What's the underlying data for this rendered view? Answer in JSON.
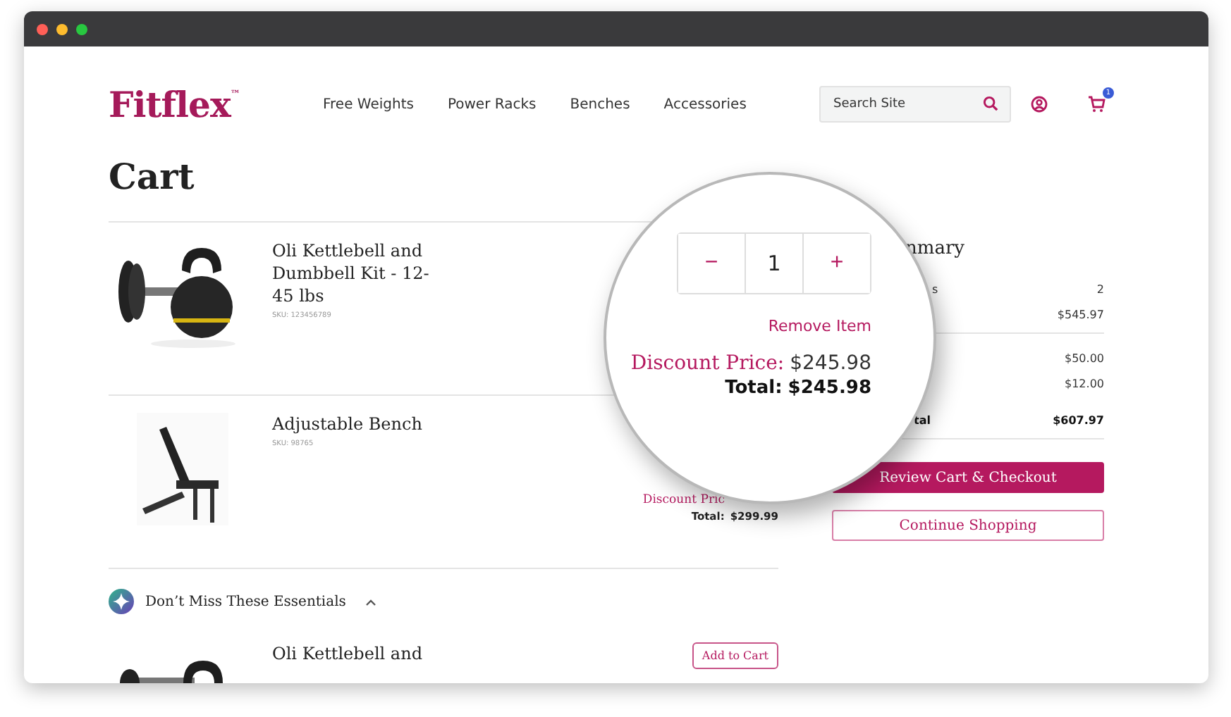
{
  "header": {
    "logo": "Fitflex",
    "logo_mark": "™",
    "nav": [
      "Free Weights",
      "Power Racks",
      "Benches",
      "Accessories"
    ],
    "search": {
      "placeholder": "Search Site"
    },
    "cart_badge": "1"
  },
  "title": "Cart",
  "items": [
    {
      "name": "Oli Kettlebell and Dumbbell Kit - 12-45 lbs",
      "sku": "SKU: 123456789"
    },
    {
      "name": "Adjustable Bench",
      "sku": "SKU: 98765",
      "discount_label": "Discount Pric",
      "total_label": "Total:",
      "total": "$299.99"
    }
  ],
  "essentials": {
    "title": "Don’t Miss These Essentials",
    "expanded": true,
    "items": [
      {
        "name": "Oli Kettlebell and",
        "button": "Add to Cart"
      }
    ]
  },
  "summary": {
    "heading": "nmary",
    "groups": [
      {
        "rows": [
          {
            "label": "s",
            "value": "2",
            "kind": "plain"
          },
          {
            "value": "$545.97",
            "kind": "plain"
          }
        ]
      },
      {
        "rows": [
          {
            "value": "$50.00",
            "kind": "plain"
          },
          {
            "value": "$12.00",
            "kind": "plain"
          }
        ]
      },
      {
        "rows": [
          {
            "label": "tal",
            "value": "$607.97",
            "kind": "total"
          }
        ]
      }
    ],
    "buttons": [
      {
        "label": "Review Cart & Checkout",
        "kind": "primary"
      },
      {
        "label": "Continue Shopping",
        "kind": "secondary"
      }
    ]
  },
  "magnifier": {
    "decrement": "−",
    "quantity": "1",
    "increment": "+",
    "remove": "Remove Item",
    "discount_label": "Discount Price:",
    "discount": "$245.98",
    "total_label": "Total:",
    "total": "$245.98"
  }
}
